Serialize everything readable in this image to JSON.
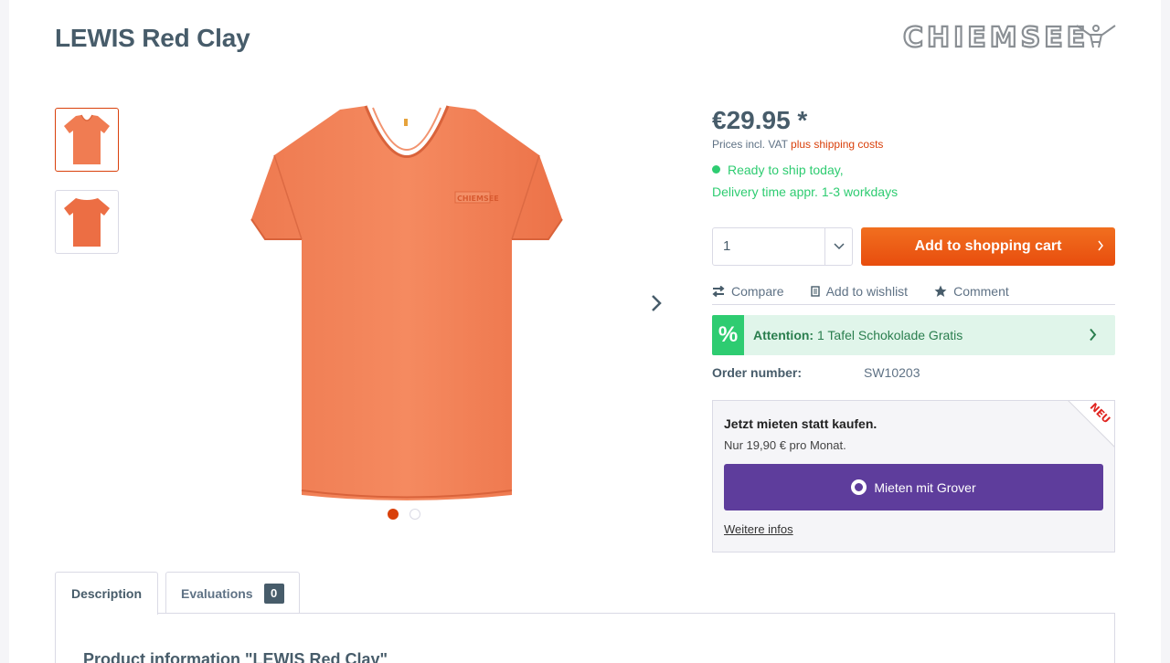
{
  "product": {
    "title": "LEWIS Red Clay",
    "brand_logo_text": "CHIEMSEE"
  },
  "gallery": {
    "thumbnails": [
      {
        "alt": "LEWIS Red Clay front",
        "active": true
      },
      {
        "alt": "LEWIS Red Clay back",
        "active": false
      }
    ],
    "slide_count": 2,
    "active_slide": 1,
    "shirt_color": "#f07c52",
    "accent_color": "#d9400b"
  },
  "buybox": {
    "price": "€29.95 *",
    "vat_text": "Prices incl. VAT ",
    "shipping_link": "plus shipping costs",
    "ship_status": "Ready to ship today,",
    "delivery_time": "Delivery time appr. 1-3 workdays",
    "quantity": "1",
    "add_to_cart": "Add to shopping cart",
    "actions": {
      "compare": "Compare",
      "wishlist": "Add to wishlist",
      "comment": "Comment"
    },
    "promo": {
      "icon": "%",
      "label": "Attention:",
      "text": " 1 Tafel Schokolade Gratis"
    },
    "order_label": "Order number:",
    "order_number": "SW10203"
  },
  "grover": {
    "heading": "Jetzt mieten statt kaufen.",
    "subtext": "Nur 19,90 € pro Monat.",
    "button": "Mieten mit Grover",
    "more_info": "Weitere infos",
    "badge": "NEU"
  },
  "tabs": {
    "description": "Description",
    "evaluations": "Evaluations",
    "evaluations_count": "0",
    "panel_title": "Product information \"LEWIS Red Clay\""
  }
}
